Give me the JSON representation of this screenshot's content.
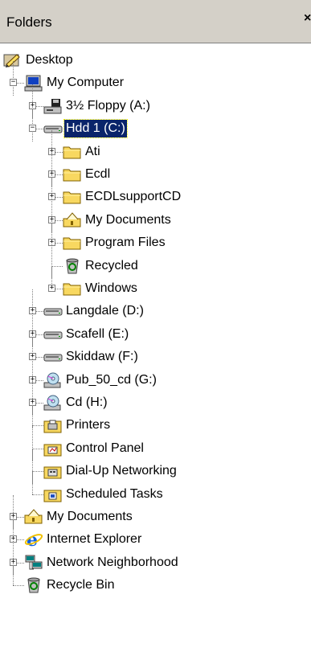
{
  "header": {
    "title": "Folders",
    "close": "×"
  },
  "tree": [
    {
      "label": "Desktop",
      "icon": "desktop-icon",
      "level": 0,
      "exp": null
    },
    {
      "label": "My Computer",
      "icon": "computer-icon",
      "level": 1,
      "exp": "−"
    },
    {
      "label": "3½ Floppy (A:)",
      "icon": "floppy-icon",
      "level": 2,
      "exp": "+"
    },
    {
      "label": "Hdd 1 (C:)",
      "icon": "drive-icon",
      "level": 2,
      "exp": "−",
      "selected": true
    },
    {
      "label": "Ati",
      "icon": "folder-icon",
      "level": 3,
      "exp": "+"
    },
    {
      "label": "Ecdl",
      "icon": "folder-icon",
      "level": 3,
      "exp": "+"
    },
    {
      "label": "ECDLsupportCD",
      "icon": "folder-icon",
      "level": 3,
      "exp": "+"
    },
    {
      "label": "My Documents",
      "icon": "my-documents-icon",
      "level": 3,
      "exp": "+"
    },
    {
      "label": "Program Files",
      "icon": "folder-icon",
      "level": 3,
      "exp": "+"
    },
    {
      "label": "Recycled",
      "icon": "recycle-bin-icon",
      "level": 3,
      "exp": null
    },
    {
      "label": "Windows",
      "icon": "folder-icon",
      "level": 3,
      "exp": "+"
    },
    {
      "label": "Langdale (D:)",
      "icon": "drive-icon",
      "level": 2,
      "exp": "+"
    },
    {
      "label": "Scafell (E:)",
      "icon": "drive-icon",
      "level": 2,
      "exp": "+"
    },
    {
      "label": "Skiddaw (F:)",
      "icon": "drive-icon",
      "level": 2,
      "exp": "+"
    },
    {
      "label": "Pub_50_cd (G:)",
      "icon": "cd-drive-icon",
      "level": 2,
      "exp": "+"
    },
    {
      "label": "Cd (H:)",
      "icon": "cd-drive-icon",
      "level": 2,
      "exp": "+"
    },
    {
      "label": "Printers",
      "icon": "printers-icon",
      "level": 2,
      "exp": null
    },
    {
      "label": "Control Panel",
      "icon": "control-panel-icon",
      "level": 2,
      "exp": null
    },
    {
      "label": "Dial-Up Networking",
      "icon": "dialup-icon",
      "level": 2,
      "exp": null
    },
    {
      "label": "Scheduled Tasks",
      "icon": "scheduled-tasks-icon",
      "level": 2,
      "exp": null
    },
    {
      "label": "My Documents",
      "icon": "my-documents-icon",
      "level": 1,
      "exp": "+"
    },
    {
      "label": "Internet Explorer",
      "icon": "internet-explorer-icon",
      "level": 1,
      "exp": "+"
    },
    {
      "label": "Network Neighborhood",
      "icon": "network-icon",
      "level": 1,
      "exp": "+"
    },
    {
      "label": "Recycle Bin",
      "icon": "recycle-bin-icon",
      "level": 1,
      "exp": null
    }
  ],
  "colors": {
    "selection": "#0a246a",
    "folder": "#f8d860",
    "header_bg": "#d4d0c8",
    "tree_line": "#808080"
  }
}
